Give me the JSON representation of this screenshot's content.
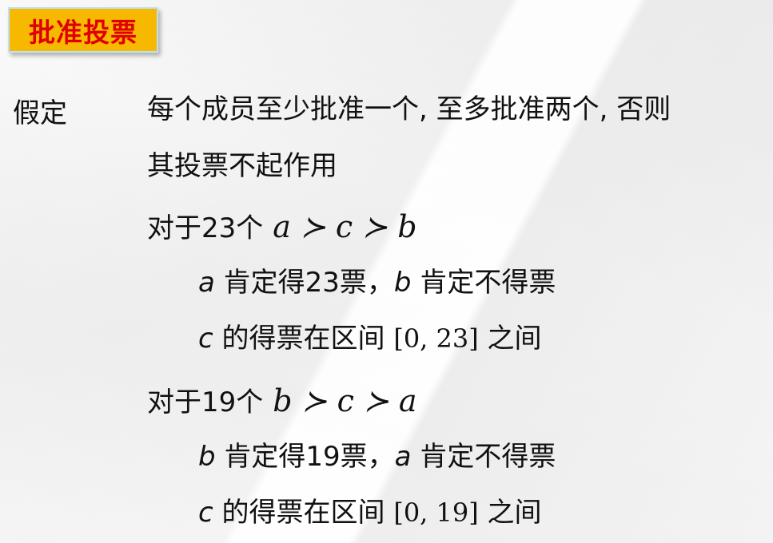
{
  "title": "批准投票",
  "assumption_label": "假定",
  "lines": {
    "l0": "每个成员至少批准一个, 至多批准两个, 否则",
    "l1": "其投票不起作用",
    "l2_prefix": "对于23个",
    "l2_math": "a ≻ c ≻ b",
    "l3_var1": "a",
    "l3_mid": " 肯定得23票，",
    "l3_var2": "b",
    "l3_end": " 肯定不得票",
    "l4_var": "c",
    "l4_mid": " 的得票在区间 ",
    "l4_interval": "[0, 23]",
    "l4_end": " 之间",
    "l5_prefix": "对于19个",
    "l5_math": "b ≻ c ≻ a",
    "l6_var1": "b",
    "l6_mid": " 肯定得19票，",
    "l6_var2": "a",
    "l6_end": " 肯定不得票",
    "l7_var": "c",
    "l7_mid": " 的得票在区间 ",
    "l7_interval": "[0, 19]",
    "l7_end": " 之间"
  },
  "colors": {
    "title_bg": "#f7b900",
    "title_text": "#e00000",
    "title_border": "#bfe0f4"
  }
}
